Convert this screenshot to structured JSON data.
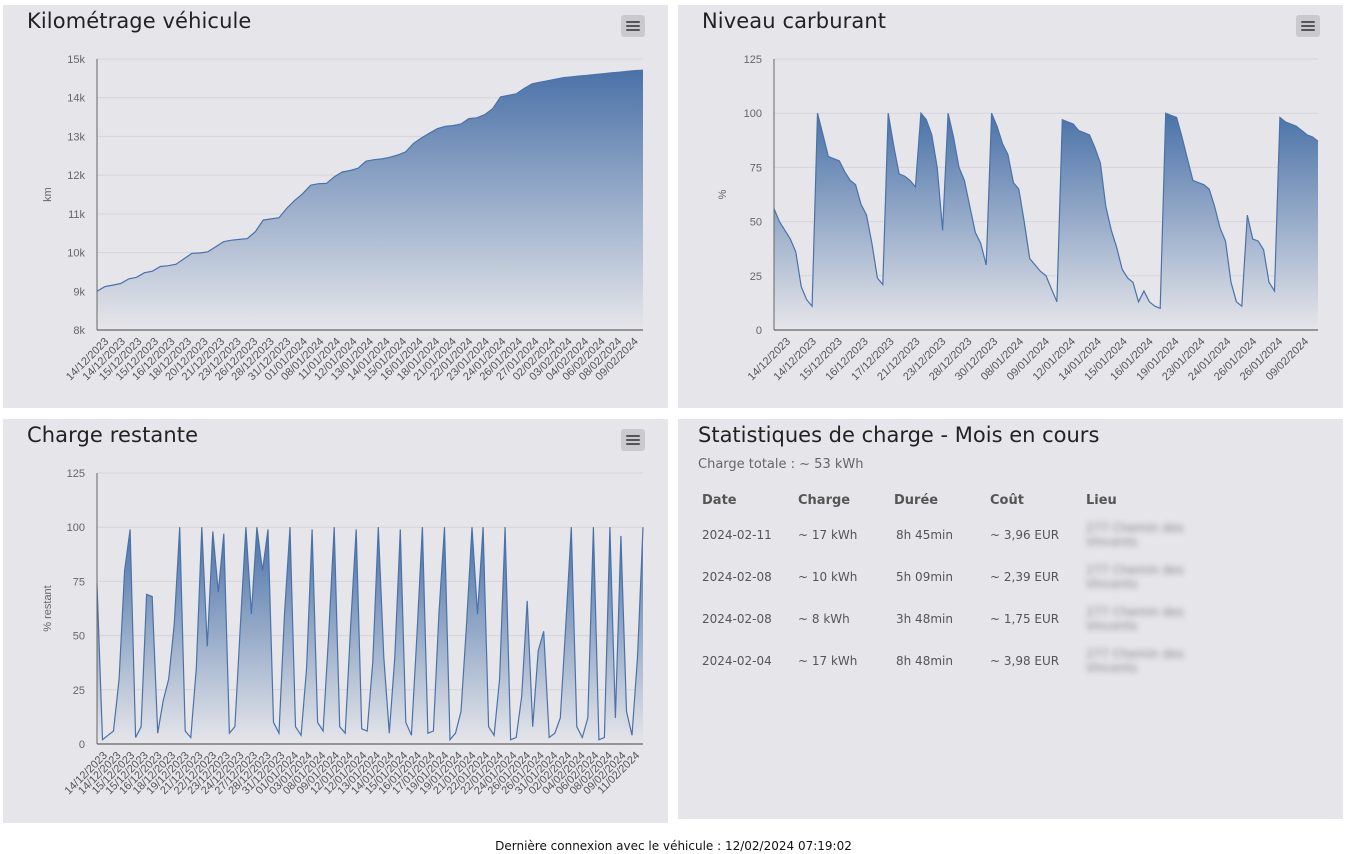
{
  "footer": "Dernière connexion avec le véhicule : 12/02/2024 07:19:02",
  "colors": {
    "line": "#4a72a8",
    "fill_top": "#4a72a8",
    "fill_bottom": "#e6e6ea",
    "panel": "#e6e6ea",
    "grid": "#d4d4da"
  },
  "icons": {
    "menu": "hamburger-menu-icon"
  },
  "chart_data": [
    {
      "type": "area",
      "title": "Kilométrage véhicule",
      "ylabel": "km",
      "ylim": [
        8000,
        15000
      ],
      "yticks": [
        8000,
        9000,
        10000,
        11000,
        12000,
        13000,
        14000,
        15000
      ],
      "ytick_labels": [
        "8k",
        "9k",
        "10k",
        "11k",
        "12k",
        "13k",
        "14k",
        "15k"
      ],
      "xtick_labels": [
        "14/12/2023",
        "14/12/2023",
        "15/12/2023",
        "15/12/2023",
        "16/12/2023",
        "18/12/2023",
        "20/12/2023",
        "21/12/2023",
        "23/12/2023",
        "26/12/2023",
        "28/12/2023",
        "31/12/2023",
        "01/01/2024",
        "08/01/2024",
        "11/01/2024",
        "12/01/2024",
        "13/01/2024",
        "14/01/2024",
        "15/01/2024",
        "16/01/2024",
        "18/01/2024",
        "21/01/2024",
        "22/01/2024",
        "23/01/2024",
        "24/01/2024",
        "26/01/2024",
        "27/01/2024",
        "02/02/2024",
        "03/02/2024",
        "04/02/2024",
        "06/02/2024",
        "08/02/2024",
        "09/02/2024"
      ],
      "values": [
        9000,
        9120,
        9160,
        9200,
        9320,
        9360,
        9480,
        9520,
        9640,
        9660,
        9700,
        9840,
        9980,
        9990,
        10020,
        10150,
        10280,
        10320,
        10340,
        10360,
        10540,
        10840,
        10870,
        10900,
        11150,
        11350,
        11520,
        11740,
        11780,
        11790,
        11960,
        12080,
        12120,
        12180,
        12360,
        12400,
        12420,
        12460,
        12520,
        12600,
        12820,
        12960,
        13080,
        13200,
        13260,
        13280,
        13320,
        13460,
        13480,
        13560,
        13720,
        14020,
        14060,
        14100,
        14240,
        14360,
        14400,
        14440,
        14480,
        14520,
        14540,
        14560,
        14580,
        14600,
        14620,
        14640,
        14660,
        14680,
        14700,
        14710
      ]
    },
    {
      "type": "area",
      "title": "Niveau carburant",
      "ylabel": "%",
      "ylim": [
        0,
        125
      ],
      "yticks": [
        0,
        25,
        50,
        75,
        100,
        125
      ],
      "ytick_labels": [
        "0",
        "25",
        "50",
        "75",
        "100",
        "125"
      ],
      "xtick_labels": [
        "14/12/2023",
        "14/12/2023",
        "15/12/2023",
        "16/12/2023",
        "17/12/2023",
        "21/12/2023",
        "23/12/2023",
        "28/12/2023",
        "30/12/2023",
        "08/01/2024",
        "09/01/2024",
        "12/01/2024",
        "14/01/2024",
        "15/01/2024",
        "16/01/2024",
        "19/01/2024",
        "23/01/2024",
        "24/01/2024",
        "26/01/2024",
        "26/01/2024",
        "09/02/2024"
      ],
      "values": [
        56,
        50,
        46,
        42,
        36,
        20,
        14,
        11,
        100,
        90,
        80,
        79,
        78,
        73,
        69,
        67,
        58,
        53,
        40,
        24,
        21,
        100,
        85,
        72,
        71,
        69,
        66,
        100,
        97,
        90,
        75,
        46,
        100,
        89,
        75,
        69,
        57,
        45,
        40,
        30,
        100,
        94,
        86,
        81,
        68,
        65,
        50,
        33,
        30,
        27,
        25,
        19,
        13,
        97,
        96,
        95,
        92,
        91,
        90,
        84,
        77,
        57,
        46,
        38,
        28,
        24,
        22,
        13,
        18,
        13,
        11,
        10,
        100,
        99,
        98,
        89,
        79,
        69,
        68,
        67,
        65,
        57,
        47,
        41,
        22,
        13,
        11,
        53,
        42,
        41,
        37,
        22,
        18,
        98,
        96,
        95,
        94,
        92,
        90,
        89,
        87
      ]
    },
    {
      "type": "area",
      "title": "Charge restante",
      "ylabel": "% restant",
      "ylim": [
        0,
        125
      ],
      "yticks": [
        0,
        25,
        50,
        75,
        100,
        125
      ],
      "ytick_labels": [
        "0",
        "25",
        "50",
        "75",
        "100",
        "125"
      ],
      "xtick_labels": [
        "14/12/2023",
        "14/12/2023",
        "15/12/2023",
        "15/12/2023",
        "16/12/2023",
        "18/12/2023",
        "19/12/2023",
        "21/12/2023",
        "22/12/2023",
        "23/12/2023",
        "24/12/2023",
        "27/12/2023",
        "28/12/2023",
        "31/12/2023",
        "01/01/2024",
        "03/01/2024",
        "08/01/2024",
        "09/01/2024",
        "12/01/2024",
        "12/01/2024",
        "13/01/2024",
        "14/01/2024",
        "15/01/2024",
        "16/01/2024",
        "17/01/2024",
        "19/01/2024",
        "19/01/2024",
        "21/01/2024",
        "22/01/2024",
        "22/01/2024",
        "24/01/2024",
        "26/01/2024",
        "26/01/2024",
        "31/01/2024",
        "02/02/2024",
        "04/02/2024",
        "06/02/2024",
        "08/02/2024",
        "09/02/2024",
        "11/02/2024"
      ],
      "values": [
        74,
        2,
        4,
        6,
        30,
        80,
        99,
        3,
        8,
        69,
        68,
        5,
        20,
        30,
        55,
        100,
        6,
        3,
        35,
        100,
        45,
        98,
        70,
        97,
        5,
        8,
        55,
        100,
        60,
        100,
        80,
        99,
        10,
        5,
        60,
        100,
        8,
        4,
        35,
        99,
        10,
        6,
        50,
        100,
        8,
        5,
        55,
        99,
        7,
        6,
        38,
        100,
        40,
        5,
        40,
        99,
        10,
        4,
        50,
        100,
        5,
        6,
        60,
        100,
        2,
        5,
        15,
        55,
        100,
        60,
        100,
        8,
        4,
        30,
        100,
        2,
        3,
        22,
        66,
        8,
        43,
        52,
        3,
        5,
        12,
        55,
        100,
        8,
        3,
        12,
        100,
        2,
        3,
        100,
        12,
        96,
        15,
        4,
        40,
        100
      ]
    }
  ],
  "stats": {
    "title": "Statistiques de charge - Mois en cours",
    "subtitle": "Charge totale : ~ 53 kWh",
    "headers": [
      "Date",
      "Charge",
      "Durée",
      "Coût",
      "Lieu"
    ],
    "rows": [
      [
        "2024-02-11",
        "~ 17 kWh",
        "8h 45min",
        "~ 3,96 EUR",
        "277 Chemin des Vincents"
      ],
      [
        "2024-02-08",
        "~ 10 kWh",
        "5h 09min",
        "~ 2,39 EUR",
        "277 Chemin des Vincents"
      ],
      [
        "2024-02-08",
        "~ 8 kWh",
        "3h 48min",
        "~ 1,75 EUR",
        "277 Chemin des Vincents"
      ],
      [
        "2024-02-04",
        "~ 17 kWh",
        "8h 48min",
        "~ 3,98 EUR",
        "277 Chemin des Vincents"
      ]
    ]
  }
}
